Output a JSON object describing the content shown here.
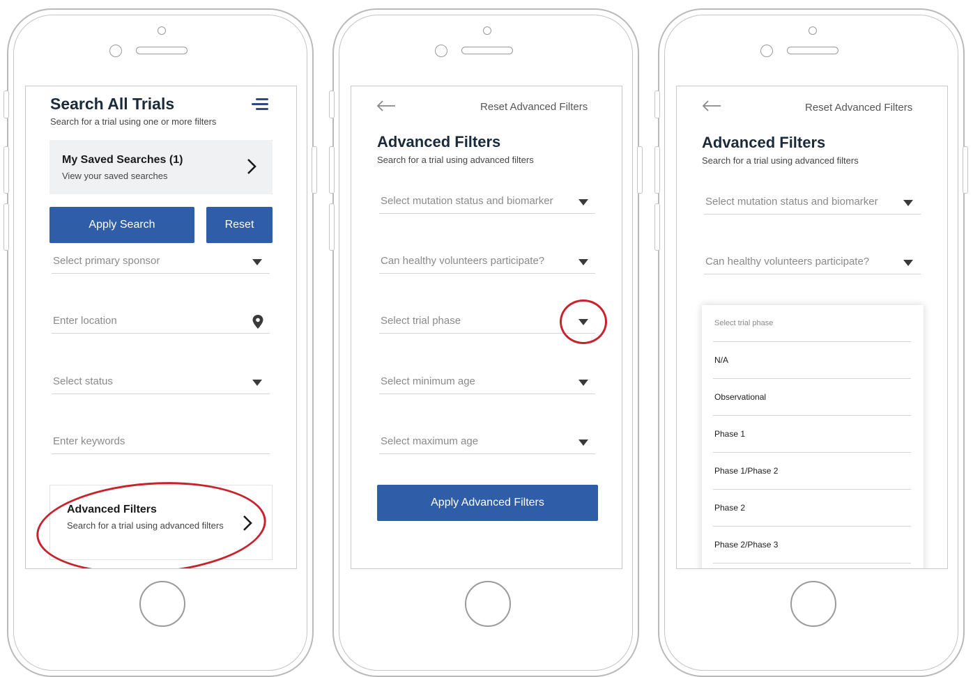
{
  "colors": {
    "primary_button": "#2f5da8",
    "highlight_ring": "#c8232c"
  },
  "icons": [
    "menu-icon",
    "chevron-right-icon",
    "dropdown-caret-icon",
    "location-pin-icon",
    "back-arrow-icon"
  ],
  "screen1": {
    "title": "Search All Trials",
    "subtitle": "Search for a trial using one or more filters",
    "saved": {
      "title": "My Saved Searches (1)",
      "subtitle": "View your saved searches"
    },
    "apply_label": "Apply Search",
    "reset_label": "Reset",
    "fields": {
      "sponsor": "Select primary sponsor",
      "location": "Enter location",
      "status": "Select status",
      "keywords": "Enter keywords"
    },
    "advanced": {
      "title": "Advanced Filters",
      "subtitle": "Search for a trial using advanced filters"
    }
  },
  "screen2": {
    "reset_link": "Reset Advanced Filters",
    "title": "Advanced Filters",
    "subtitle": "Search for a trial using advanced filters",
    "fields": {
      "mutation": "Select mutation status and biomarker",
      "volunteers": "Can healthy volunteers participate?",
      "phase": "Select trial phase",
      "min_age": "Select minimum age",
      "max_age": "Select maximum age"
    },
    "apply_label": "Apply Advanced Filters"
  },
  "screen3": {
    "reset_link": "Reset Advanced Filters",
    "title": "Advanced Filters",
    "subtitle": "Search for a trial using advanced filters",
    "fields": {
      "mutation": "Select mutation status and biomarker",
      "volunteers": "Can healthy volunteers participate?"
    },
    "dropdown": {
      "header": "Select trial phase",
      "options": [
        "N/A",
        "Observational",
        "Phase 1",
        "Phase 1/Phase 2",
        "Phase 2",
        "Phase 2/Phase 3"
      ]
    }
  }
}
